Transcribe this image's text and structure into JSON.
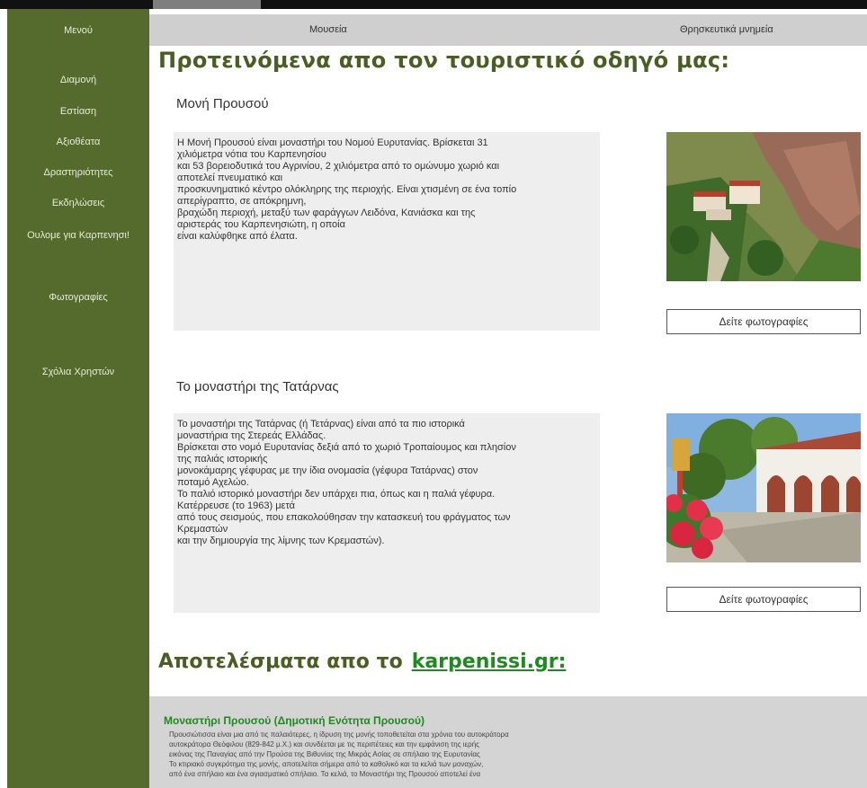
{
  "sidebar": {
    "items": [
      {
        "label": "Μενού"
      },
      {
        "label": "Διαμονή"
      },
      {
        "label": "Εστίαση"
      },
      {
        "label": "Αξιοθέατα"
      },
      {
        "label": "Δραστηριότητες"
      },
      {
        "label": "Εκδηλώσεις"
      },
      {
        "label": "Ουλομε για Καρπενησι!"
      },
      {
        "label": "Φωτογραφίες"
      },
      {
        "label": "Σχόλια Χρηστών"
      }
    ]
  },
  "tabs": [
    {
      "label": "Μουσεία"
    },
    {
      "label": "Θρησκευτικά μνημεία"
    }
  ],
  "headline": "Προτεινόμενα απο τον τουριστικό οδηγό μας:",
  "sites": [
    {
      "title": "Μονή Προυσού",
      "lines": [
        "Η Μονή Προυσού είναι μοναστήρι του Νομού Ευρυτανίας. Βρίσκεται 31",
        "χιλιόμετρα νότια του Καρπενησίου",
        "και 53 βορειοδυτικά του Αγρινίου, 2 χιλιόμετρα από το ομώνυμο χωριό και",
        "αποτελεί πνευματικό και",
        "προσκυνηματικό κέντρο ολόκληρης της περιοχής. Είναι χτισμένη σε ένα τοπίο",
        "απερίγραπτο, σε απόκρημνη,",
        "βραχώδη περιοχή, μεταξύ των φαράγγων Λειδόνα, Κανιάσκα και της",
        "αριστεράς του Καρπενησιώτη, η οποία",
        "είναι καλύφθηκε από έλατα."
      ],
      "button": "Δείτε φωτογραφίες"
    },
    {
      "title": "Το μοναστήρι της Τατάρνας",
      "lines": [
        "Το μοναστήρι της Τατάρνας (ή Τετάρνας) είναι από τα πιο ιστορικά",
        "μοναστήρια της Στερεάς Ελλάδας.",
        "Βρίσκεται στο νομό Ευρυτανίας δεξιά από το χωριό Τροπαίουμος και πλησίον",
        "της παλιάς ιστορικής",
        "μονοκάμαρης γέφυρας με την ίδια ονομασία (γέφυρα Τατάρνας) στον",
        "ποταμό Αχελώο.",
        "Το παλιό ιστορικό μοναστήρι δεν υπάρχει πια, όπως και η παλιά γέφυρα.",
        "Κατέρρευσε (το 1963) μετά",
        "από τους σεισμούς, που επακολούθησαν την κατασκευή του φράγματος των",
        "Κρεμαστών",
        "και την δημιουργία της λίμνης των Κρεμαστών)."
      ],
      "button": "Δείτε φωτογραφίες"
    }
  ],
  "results": {
    "prefix": "Αποτελέσματα απο το",
    "link": "karpenissi.gr:",
    "entry_title": "Μοναστήρι Προυσού (Δημοτική Ενότητα Προυσού)",
    "snippet_lines": [
      "Προυσιώτισσα είναι μια από τις παλαιότερες, η ίδρυση της μονής τοποθετείται στα χρόνια του αυτοκράτορα",
      "αυτοκράτορα Θεόφιλου (829-842 μ.Χ.) και συνδέεται με τις περιπέτειες και την εμφάνιση της ιερής",
      "εικόνας της Παναγίας από την Προύσα της Βιθυνίας της Μικράς Ασίας σε σπήλαιο της Ευρυτανίας",
      "Το κτιριακό συγκρότημα της μονής, αποτελείται σήμερα από το καθολικό και τα κελιά των μοναχών,",
      "από ένα σπήλαιο και ένα αγιασματικό σπήλαιο. Τα κελιά, το Μοναστήρι της Προυσού αποτελεί ένα"
    ]
  }
}
